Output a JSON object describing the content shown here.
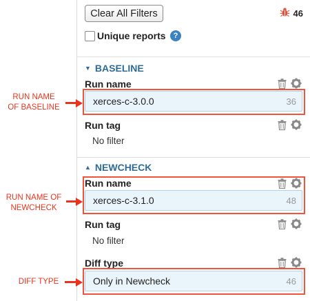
{
  "top": {
    "clear_filters_label": "Clear All Filters",
    "bug_count": "46",
    "unique_reports_label": "Unique reports",
    "help_glyph": "?"
  },
  "baseline": {
    "title": "BASELINE",
    "run_name_label": "Run name",
    "run_name_value": "xerces-c-3.0.0",
    "run_name_count": "36",
    "run_tag_label": "Run tag",
    "run_tag_value": "No filter"
  },
  "newcheck": {
    "title": "NEWCHECK",
    "run_name_label": "Run name",
    "run_name_value": "xerces-c-3.1.0",
    "run_name_count": "48",
    "run_tag_label": "Run tag",
    "run_tag_value": "No filter",
    "diff_type_label": "Diff type",
    "diff_type_value": "Only in Newcheck",
    "diff_type_count": "46"
  },
  "annotations": {
    "baseline_line1": "RUN NAME",
    "baseline_line2": "OF BASELINE",
    "newcheck_line1": "RUN NAME OF",
    "newcheck_line2": "NEWCHECK",
    "diff_type": "DIFF TYPE"
  },
  "colors": {
    "accent": "#2f6b97",
    "annotation": "#e8341c",
    "field_bg": "#eaf4fb",
    "help": "#3a83c0"
  }
}
